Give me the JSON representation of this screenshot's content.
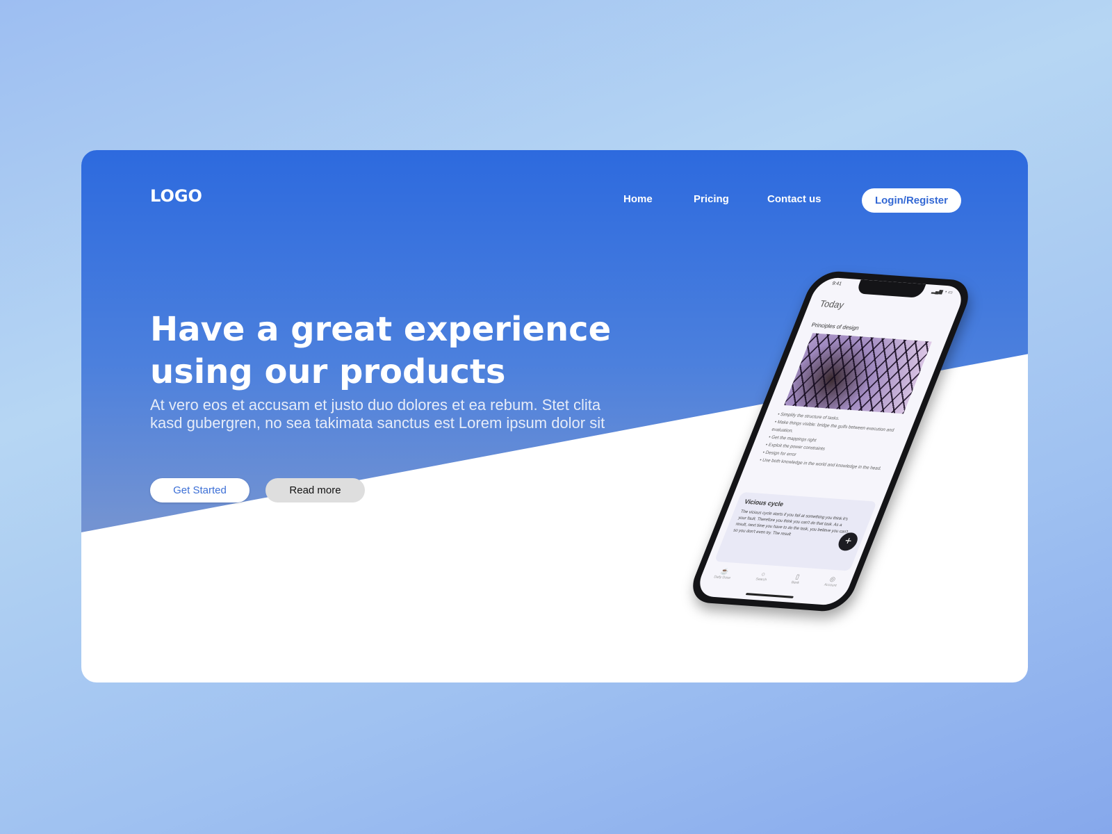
{
  "nav": {
    "logo": "LOGO",
    "links": [
      "Home",
      "Pricing",
      "Contact us"
    ],
    "login": "Login/Register"
  },
  "hero": {
    "headline": "Have a great experience using our products",
    "subtext": "At vero eos et accusam et justo duo dolores et ea rebum. Stet clita kasd gubergren, no sea takimata sanctus est Lorem ipsum dolor sit",
    "primary_button": "Get Started",
    "secondary_button": "Read more"
  },
  "phone": {
    "status_time": "9:41",
    "title": "Today",
    "section": "Principles of design",
    "bullets": [
      "Simplify the structure of tasks.",
      "Make things visible: bridge the gulfs between execution and evaluation.",
      "Get the mappings right",
      "Exploit the power constraints",
      "Design for error",
      "Use both knowledge in the world and knowledge in the head."
    ],
    "card_title": "Vicious cycle",
    "card_text": "The vicious cycle starts if you fail at something you think it's your fault. Therefore you think you can't do that task. As a result, next time you have to do the task, you believe you can't, so you don't even try. The result",
    "tabs": [
      "Daily Dose",
      "Search",
      "Bank",
      "Account"
    ]
  },
  "colors": {
    "hero_top": "#2d6ade",
    "hero_bottom": "#7a96cf",
    "button_text": "#3c6fd6"
  }
}
